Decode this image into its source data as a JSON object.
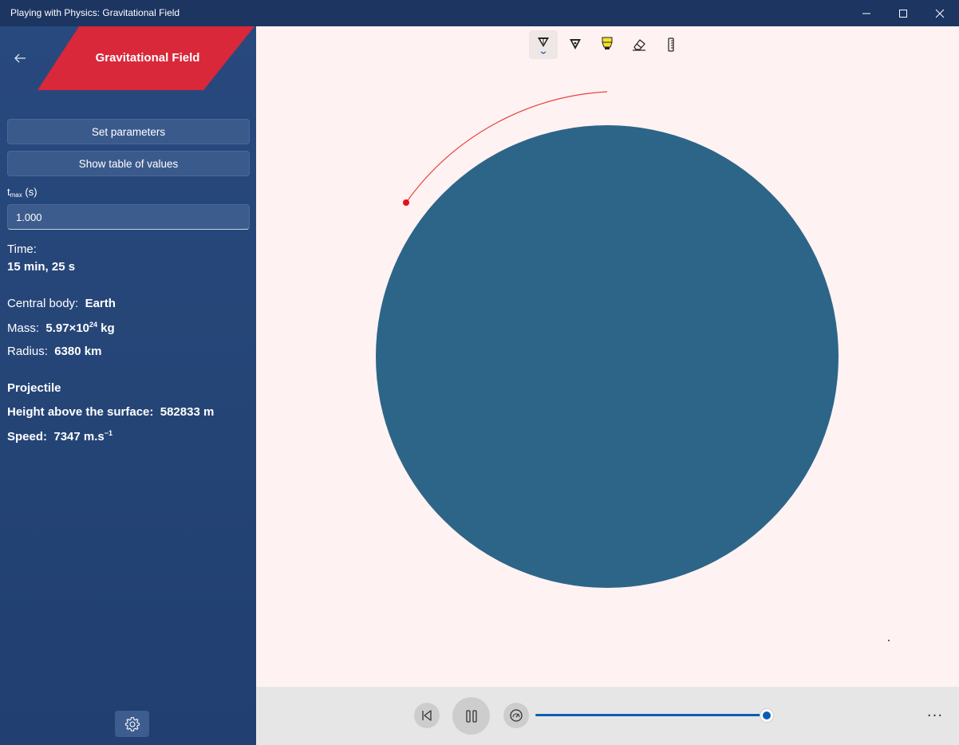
{
  "window": {
    "title": "Playing with Physics: Gravitational Field",
    "minimize_icon": "minimize-icon",
    "maximize_icon": "maximize-icon",
    "close_icon": "close-icon"
  },
  "sidebar": {
    "back_icon": "arrow-left-icon",
    "banner_title": "Gravitational Field",
    "banner_color": "#d8283a",
    "set_parameters_label": "Set parameters",
    "show_table_label": "Show table of values",
    "tmax_label_main": "t",
    "tmax_label_sub": "max",
    "tmax_label_unit": " (s)",
    "tmax_value": "1.000",
    "time_label": "Time:",
    "time_value": "15 min, 25 s",
    "central_body_label": "Central body:",
    "central_body_value": "Earth",
    "mass_label": "Mass:",
    "mass_value_base": "5.97×10",
    "mass_value_exp": "24",
    "mass_value_unit": " kg",
    "radius_label": "Radius:",
    "radius_value": "6380 km",
    "projectile_heading": "Projectile",
    "height_label": "Height above the surface:",
    "height_value": "582833 m",
    "speed_label": "Speed:",
    "speed_value_base": "7347 m.s",
    "speed_value_exp": "−1",
    "settings_icon": "gear-icon"
  },
  "canvas": {
    "background": "#fff2f2",
    "planet_color": "#2d6588",
    "trajectory_color": "#e8403a",
    "projectile_color": "#e8101a",
    "tools": [
      "ballpoint-pen-icon",
      "pencil-icon",
      "highlighter-icon",
      "eraser-icon",
      "ruler-icon"
    ]
  },
  "playback": {
    "restart_icon": "skip-back-icon",
    "pause_icon": "pause-icon",
    "speed_icon": "speedometer-icon",
    "slider_value": 1.0,
    "more_label": "···",
    "accent": "#0a5fb4"
  }
}
